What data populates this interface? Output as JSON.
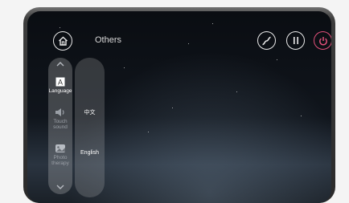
{
  "header": {
    "title": "Others",
    "home_icon": "home-icon",
    "icons": [
      "trend-icon",
      "pause-icon",
      "power-icon"
    ],
    "power_color": "#e0507a"
  },
  "sidebar": {
    "items": [
      {
        "label": "Language",
        "icon": "language-icon",
        "active": true
      },
      {
        "label": "Touch sound",
        "icon": "speaker-icon",
        "active": false
      },
      {
        "label": "Photo therapy",
        "icon": "photo-icon",
        "active": false
      }
    ]
  },
  "language_options": [
    "中文",
    "English"
  ]
}
